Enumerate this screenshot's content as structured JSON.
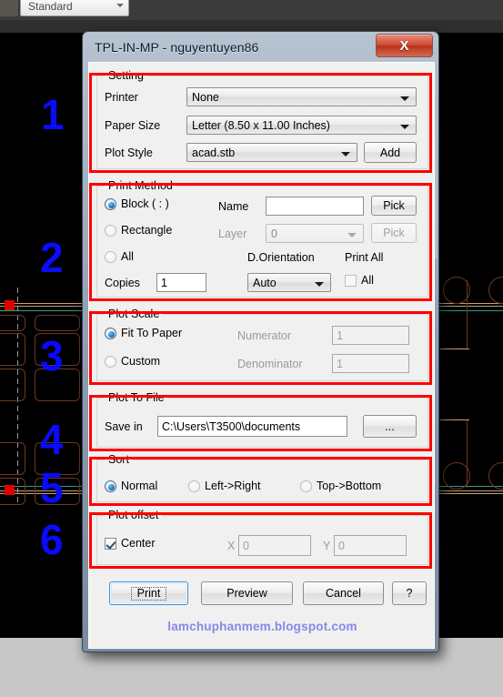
{
  "background": {
    "app_toolbar": {
      "style_combo_value": "Standard"
    },
    "annotation_numbers": [
      "1",
      "2",
      "3",
      "4",
      "5",
      "6"
    ]
  },
  "dialog": {
    "title": "TPL-IN-MP - nguyentuyen86",
    "close_label": "X",
    "watermark": "lamchuphanmem.blogspot.com",
    "setting": {
      "legend": "Setting",
      "printer_label": "Printer",
      "printer_value": "None",
      "paper_size_label": "Paper Size",
      "paper_size_value": "Letter (8.50 x 11.00 Inches)",
      "plot_style_label": "Plot Style",
      "plot_style_value": "acad.stb",
      "add_label": "Add"
    },
    "print_method": {
      "legend": "Print Method",
      "radio_block": "Block ( : )",
      "radio_rectangle": "Rectangle",
      "radio_all": "All",
      "selected_radio": "Block ( : )",
      "name_label": "Name",
      "name_value": "",
      "name_pick_label": "Pick",
      "layer_label": "Layer",
      "layer_value": "0",
      "layer_pick_label": "Pick",
      "copies_label": "Copies",
      "copies_value": "1",
      "d_orientation_label": "D.Orientation",
      "d_orientation_value": "Auto",
      "print_all_label": "Print All",
      "print_all_checkbox_label": "All",
      "print_all_checked": false
    },
    "plot_scale": {
      "legend": "Plot Scale",
      "radio_fit": "Fit To Paper",
      "radio_custom": "Custom",
      "selected_radio": "Fit To Paper",
      "numerator_label": "Numerator",
      "numerator_value": "1",
      "denominator_label": "Denominator",
      "denominator_value": "1"
    },
    "plot_to_file": {
      "legend": "Plot To File",
      "save_in_label": "Save in",
      "save_in_value": "C:\\Users\\T3500\\documents",
      "browse_label": "..."
    },
    "sort": {
      "legend": "Sort",
      "radio_normal": "Normal",
      "radio_left_right": "Left->Right",
      "radio_top_bottom": "Top->Bottom",
      "selected_radio": "Normal"
    },
    "plot_offset": {
      "legend": "Plot offset",
      "center_label": "Center",
      "center_checked": true,
      "x_label": "X",
      "x_value": "0",
      "y_label": "Y",
      "y_value": "0"
    },
    "buttons": {
      "print_label": "Print",
      "preview_label": "Preview",
      "cancel_label": "Cancel",
      "help_label": "?"
    }
  },
  "colors": {
    "annotation_red": "#ff0000",
    "annotation_blue": "#0a0aff",
    "watermark_purple": "#8888e8",
    "close_red": "#d04b33"
  }
}
